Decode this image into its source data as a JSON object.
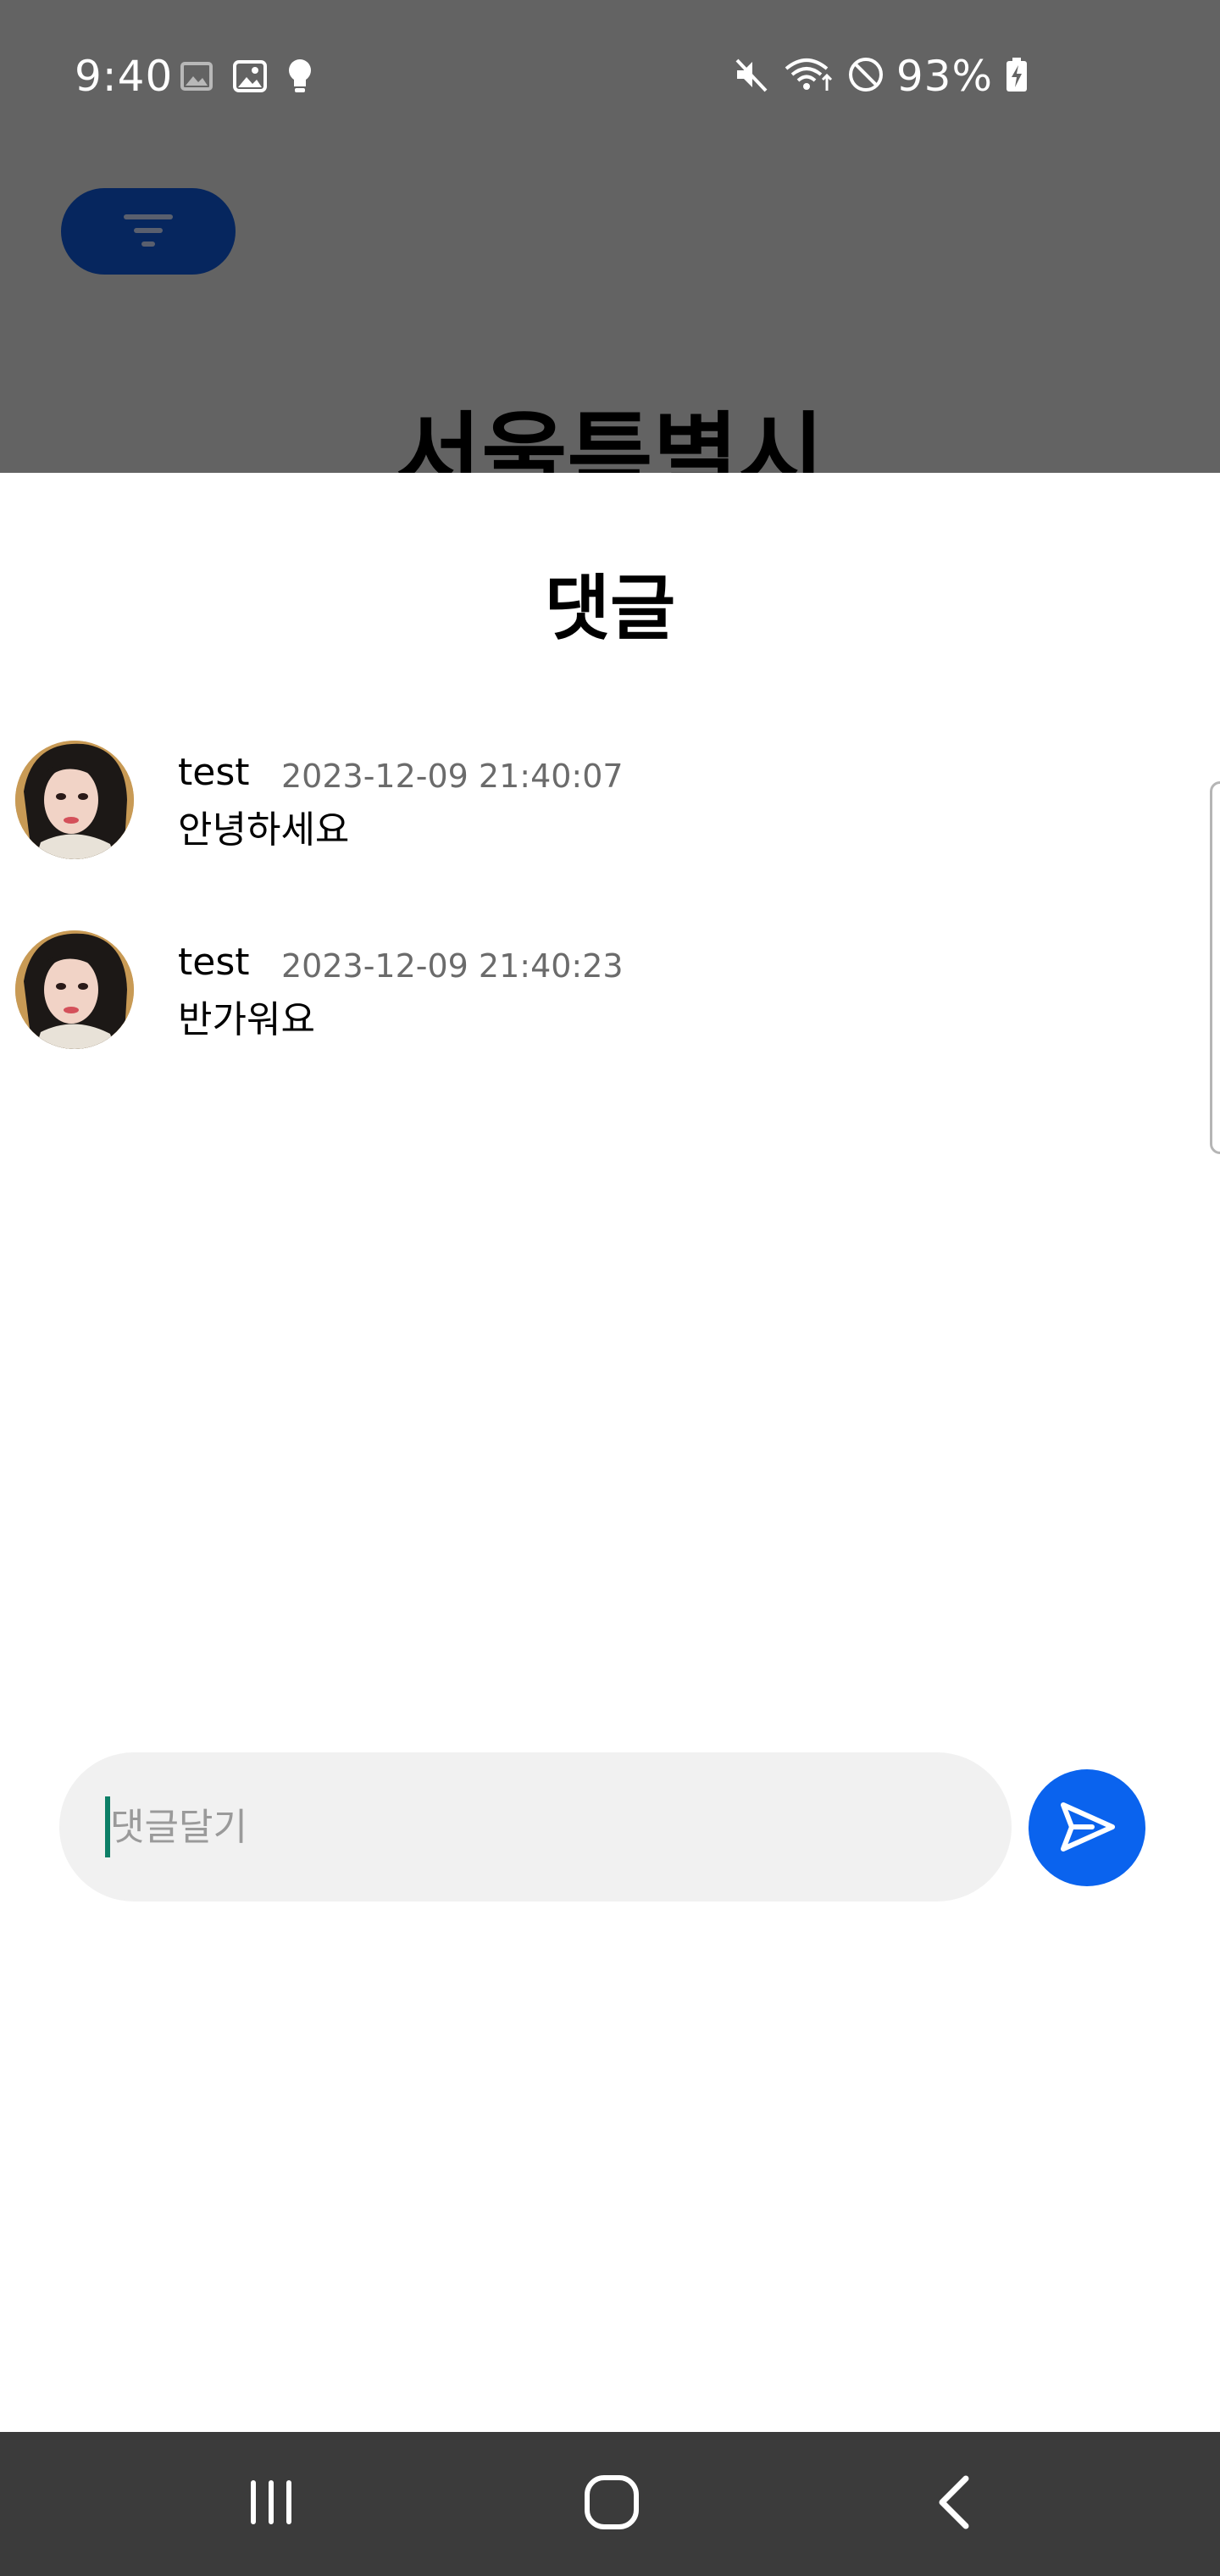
{
  "status_bar": {
    "time": "9:40",
    "battery_percent": "93%",
    "left_icons": [
      "gallery-icon",
      "image-icon",
      "bulb-icon"
    ],
    "right_icons": [
      "mute-icon",
      "wifi-icon",
      "do-not-disturb-icon",
      "battery-charging-icon"
    ]
  },
  "background_page": {
    "title_fragment": "서울특별시",
    "filter_icon": "filter-icon",
    "accent_color": "#06265e"
  },
  "sheet": {
    "title": "댓글",
    "comments": [
      {
        "user": "test",
        "time": "2023-12-09 21:40:07",
        "text": "안녕하세요"
      },
      {
        "user": "test",
        "time": "2023-12-09 21:40:23",
        "text": "반가워요"
      }
    ]
  },
  "input": {
    "placeholder": "댓글달기",
    "value": ""
  },
  "send_button": {
    "icon": "send-icon",
    "color": "#0a63ee"
  },
  "nav_bar": {
    "buttons": [
      "recent-apps-icon",
      "home-icon",
      "back-icon"
    ]
  }
}
